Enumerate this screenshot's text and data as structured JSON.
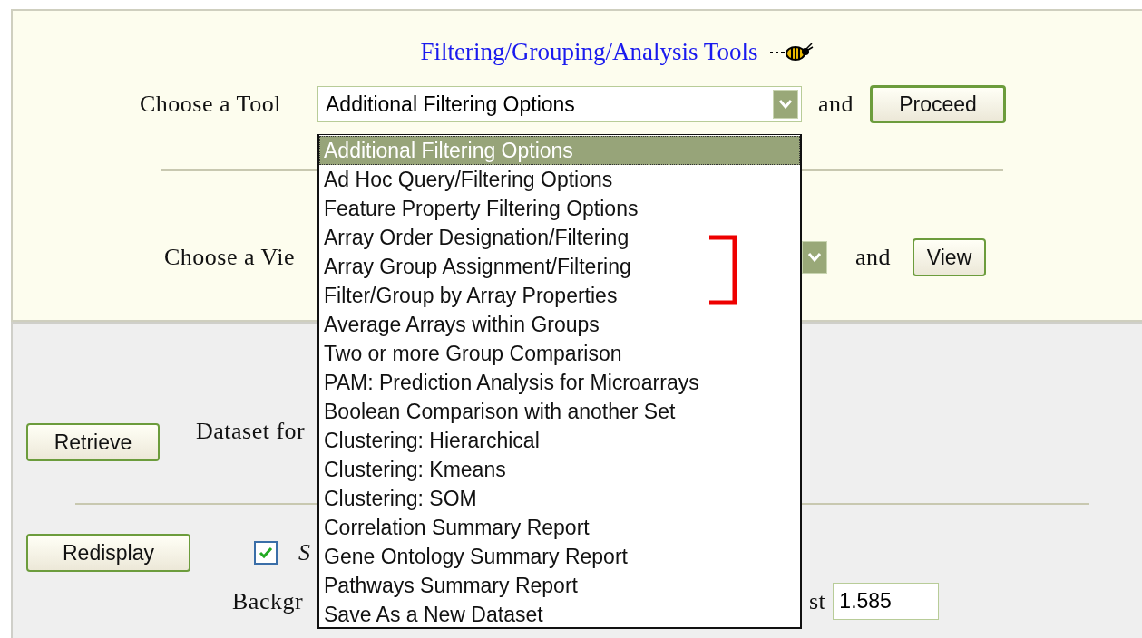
{
  "title": "Filtering/Grouping/Analysis Tools",
  "tool_row": {
    "label": "Choose a Tool",
    "select_value": "Additional Filtering Options",
    "conjunction": "and",
    "button": "Proceed"
  },
  "view_row": {
    "label": "Choose a Vie",
    "conjunction": "and",
    "button": "View"
  },
  "dataset_row": {
    "button": "Retrieve",
    "label": "Dataset for"
  },
  "display_row": {
    "button": "Redisplay",
    "checkbox": {
      "checked": true,
      "label": "S"
    },
    "background_label": "Backgr",
    "threshold_label": "st",
    "threshold_value": "1.585"
  },
  "dropdown": {
    "options": [
      {
        "label": "Additional Filtering Options",
        "selected": true
      },
      {
        "label": "Ad Hoc Query/Filtering Options",
        "selected": false
      },
      {
        "label": "Feature Property Filtering Options",
        "selected": false
      },
      {
        "label": "Array Order Designation/Filtering",
        "selected": false
      },
      {
        "label": "Array Group Assignment/Filtering",
        "selected": false
      },
      {
        "label": "Filter/Group by Array Properties",
        "selected": false
      },
      {
        "label": "Average Arrays within Groups",
        "selected": false
      },
      {
        "label": "Two or more Group Comparison",
        "selected": false
      },
      {
        "label": "PAM: Prediction Analysis for Microarrays",
        "selected": false
      },
      {
        "label": "Boolean Comparison with another Set",
        "selected": false
      },
      {
        "label": "Clustering: Hierarchical",
        "selected": false
      },
      {
        "label": "Clustering: Kmeans",
        "selected": false
      },
      {
        "label": "Clustering: SOM",
        "selected": false
      },
      {
        "label": "Correlation Summary Report",
        "selected": false
      },
      {
        "label": "Gene Ontology Summary Report",
        "selected": false
      },
      {
        "label": "Pathways Summary Report",
        "selected": false
      },
      {
        "label": "Save As a New Dataset",
        "selected": false
      }
    ]
  }
}
